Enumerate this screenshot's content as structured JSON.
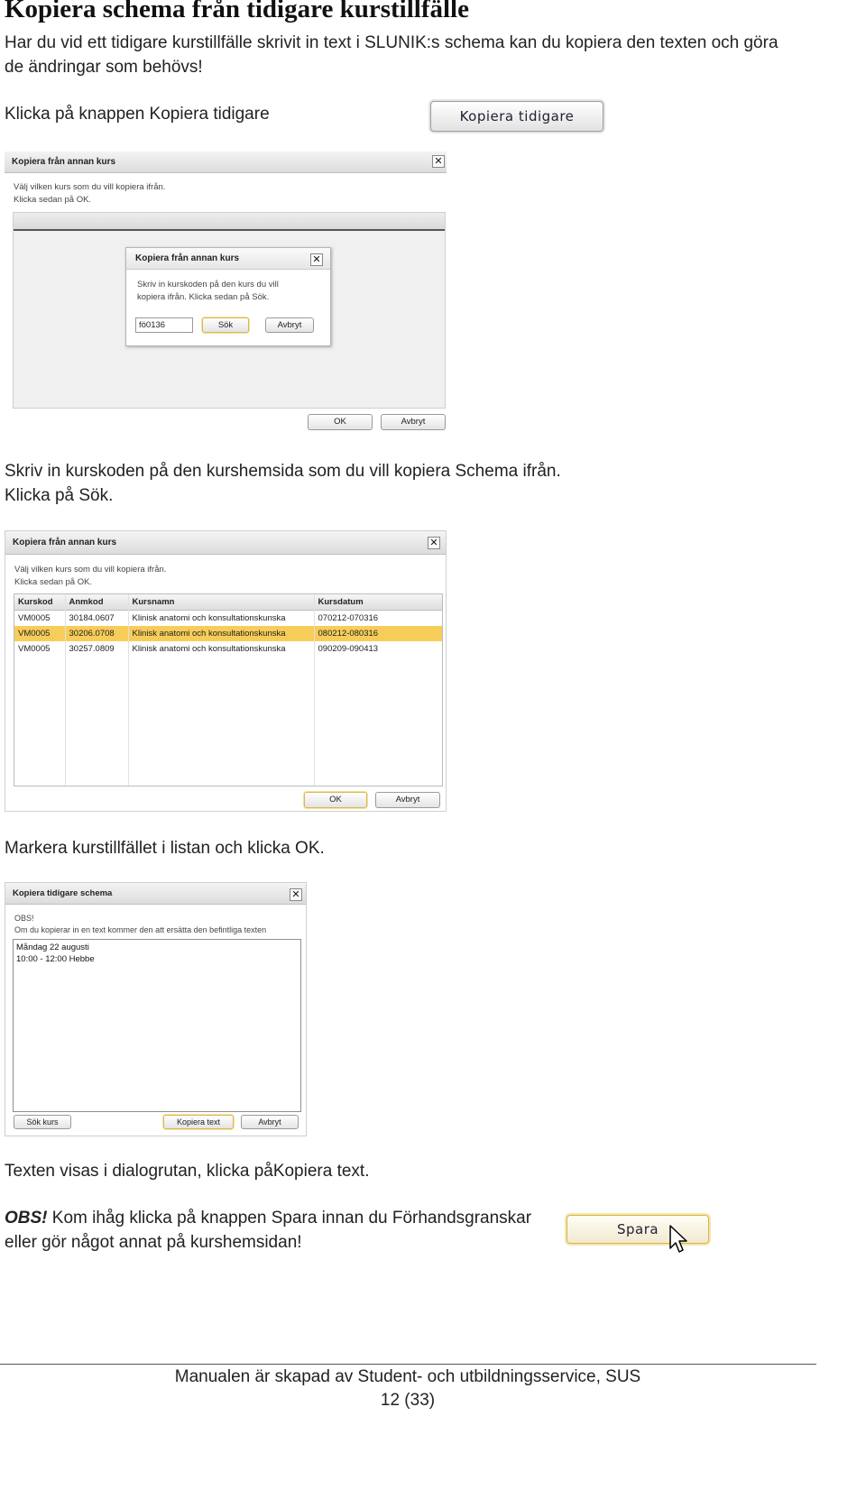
{
  "heading": "Kopiera schema från tidigare kurstillfälle",
  "intro": {
    "line1": "Har du vid ett tidigare kurstillfälle skrivit in text i SLUNIK:s schema kan du kopiera den texten och göra",
    "line2": "de ändringar som behövs!"
  },
  "step1": {
    "text": "Klicka på knappen Kopiera tidigare",
    "button_label": "Kopiera tidigare"
  },
  "shot1": {
    "title": "Kopiera från annan kurs",
    "instr1": "Välj vilken kurs som du vill kopiera ifrån.",
    "instr2": "Klicka sedan på OK.",
    "inner": {
      "title": "Kopiera från annan kurs",
      "text1": "Skriv in kurskoden på den kurs du vill",
      "text2": "kopiera ifrån. Klicka sedan på Sök.",
      "input_value": "fö0136",
      "search_label": "Sök",
      "cancel_label": "Avbryt"
    },
    "ok_label": "OK",
    "cancel_label": "Avbryt"
  },
  "step2": {
    "line1": "Skriv in kurskoden på den kurshemsida som du vill kopiera Schema ifrån.",
    "line2": "Klicka på Sök."
  },
  "shot2": {
    "title": "Kopiera från annan kurs",
    "instr1": "Välj vilken kurs som du vill kopiera ifrån.",
    "instr2": "Klicka sedan på OK.",
    "columns": [
      "Kurskod",
      "Anmkod",
      "Kursnamn",
      "Kursdatum"
    ],
    "rows": [
      [
        "VM0005",
        "30184.0607",
        "Klinisk anatomi och konsultationskunska",
        "070212-070316"
      ],
      [
        "VM0005",
        "30206.0708",
        "Klinisk anatomi och konsultationskunska",
        "080212-080316"
      ],
      [
        "VM0005",
        "30257.0809",
        "Klinisk anatomi och konsultationskunska",
        "090209-090413"
      ]
    ],
    "ok_label": "OK",
    "cancel_label": "Avbryt"
  },
  "step3": {
    "text": "Markera kurstillfället i listan och klicka OK."
  },
  "shot3": {
    "title": "Kopiera tidigare schema",
    "obs": "OBS!",
    "warning": "Om du kopierar in en text kommer den att ersätta den befintliga texten",
    "text_line1": "Måndag  22 augusti",
    "text_line2": "10:00 - 12:00 Hebbe",
    "search_course_label": "Sök kurs",
    "copy_text_label": "Kopiera text",
    "cancel_label": "Avbryt"
  },
  "step4": {
    "text": "Texten visas i dialogrutan, klicka påKopiera text."
  },
  "obs_note": {
    "label": "OBS!",
    "line1": " Kom ihåg klicka på knappen Spara innan du Förhandsgranskar",
    "line2": "eller gör något annat på kurshemsidan!",
    "save_label": "Spara"
  },
  "footer": {
    "line1": "Manualen är skapad av Student- och utbildningsservice, SUS",
    "line2": "12 (33)"
  }
}
